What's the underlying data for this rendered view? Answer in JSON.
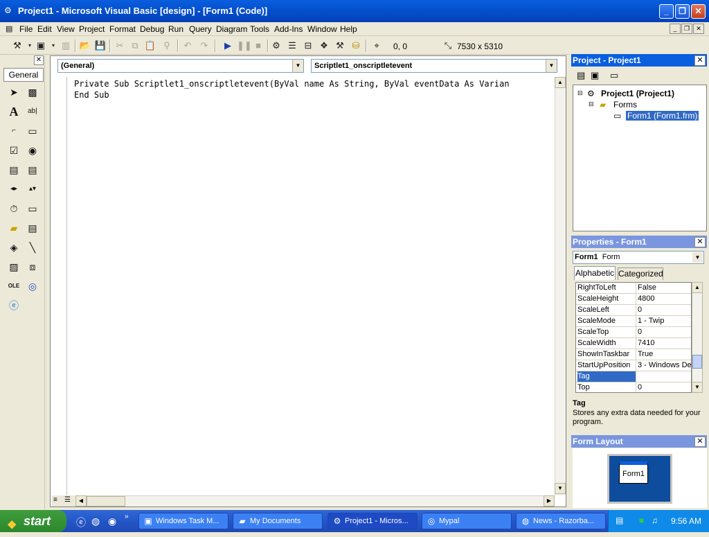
{
  "window": {
    "title": "Project1 - Microsoft Visual Basic [design] - [Form1 (Code)]",
    "minimize_icon": "minimize-icon",
    "maximize_icon": "maximize-icon",
    "close_icon": "close-icon"
  },
  "menu": {
    "items": [
      "File",
      "Edit",
      "View",
      "Project",
      "Format",
      "Debug",
      "Run",
      "Query",
      "Diagram",
      "Tools",
      "Add-Ins",
      "Window",
      "Help"
    ]
  },
  "toolbar": {
    "position": "0, 0",
    "size": "7530 x 5310"
  },
  "toolbox": {
    "tab_label": "General"
  },
  "code_window": {
    "object_combo": "(General)",
    "procedure_combo": "Scriptlet1_onscriptletevent",
    "lines": [
      "Private Sub Scriptlet1_onscriptletevent(ByVal name As String, ByVal eventData As Varian",
      "",
      "End Sub"
    ]
  },
  "project_panel": {
    "title": "Project - Project1",
    "root": "Project1 (Project1)",
    "folder": "Forms",
    "file": "Form1 (Form1.frm)"
  },
  "properties_panel": {
    "title": "Properties - Form1",
    "object_name": "Form1",
    "object_type": "Form",
    "tab_alphabetic": "Alphabetic",
    "tab_categorized": "Categorized",
    "rows": [
      {
        "name": "RightToLeft",
        "value": "False"
      },
      {
        "name": "ScaleHeight",
        "value": "4800"
      },
      {
        "name": "ScaleLeft",
        "value": "0"
      },
      {
        "name": "ScaleMode",
        "value": "1 - Twip"
      },
      {
        "name": "ScaleTop",
        "value": "0"
      },
      {
        "name": "ScaleWidth",
        "value": "7410"
      },
      {
        "name": "ShowInTaskbar",
        "value": "True"
      },
      {
        "name": "StartUpPosition",
        "value": "3 - Windows Del"
      },
      {
        "name": "Tag",
        "value": ""
      },
      {
        "name": "Top",
        "value": "0"
      }
    ],
    "description_title": "Tag",
    "description_text": "Stores any extra data needed for your program."
  },
  "form_layout": {
    "title": "Form Layout",
    "form_label": "Form1"
  },
  "taskbar": {
    "start_label": "start",
    "buttons": [
      {
        "label": "Windows Task M...",
        "icon": "task-manager-icon"
      },
      {
        "label": "My Documents",
        "icon": "folder-icon"
      },
      {
        "label": "Project1 - Micros...",
        "icon": "vb-icon"
      },
      {
        "label": "Mypal",
        "icon": "browser-icon"
      },
      {
        "label": "News - Razorba...",
        "icon": "news-icon"
      }
    ],
    "clock": "9:56 AM"
  }
}
